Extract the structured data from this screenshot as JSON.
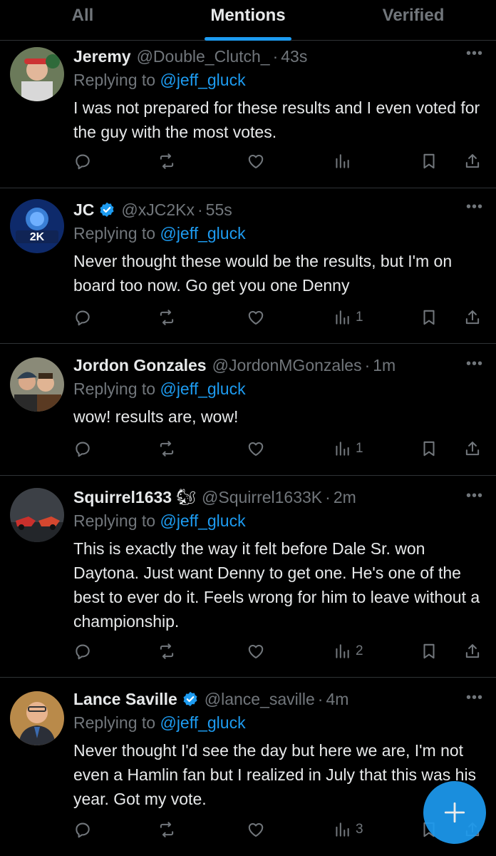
{
  "tabs": [
    {
      "label": "All"
    },
    {
      "label": "Mentions"
    },
    {
      "label": "Verified"
    }
  ],
  "reply_prefix": "Replying to",
  "more_label": "•••",
  "colors": {
    "accent": "#1d9bf0",
    "muted": "#71767b",
    "text": "#e7e9ea",
    "background": "#000000",
    "divider": "#2f3336"
  },
  "tweets": [
    {
      "name": "Jeremy",
      "verified": false,
      "emoji": "",
      "handle": "@Double_Clutch_",
      "time": "43s",
      "reply_to": "@jeff_gluck",
      "text": "I was not prepared for these results and I even voted for the guy with the most votes.",
      "views": ""
    },
    {
      "name": "JC",
      "verified": true,
      "emoji": "",
      "handle": "@xJC2Kx",
      "time": "55s",
      "reply_to": "@jeff_gluck",
      "text": "Never thought these would be the results, but I'm on board too now. Go get you one Denny",
      "views": "1"
    },
    {
      "name": "Jordon Gonzales",
      "verified": false,
      "emoji": "",
      "handle": "@JordonMGonzales",
      "time": "1m",
      "reply_to": "@jeff_gluck",
      "text": "wow! results are, wow!",
      "views": "1"
    },
    {
      "name": "Squirrel1633",
      "verified": false,
      "emoji": "🐿",
      "handle": "@Squirrel1633K",
      "time": "2m",
      "reply_to": "@jeff_gluck",
      "text": "This is exactly the way it felt before Dale Sr. won Daytona.  Just want Denny to get one.   He's one of the best to ever do it.  Feels wrong for him to leave without a championship.",
      "views": "2"
    },
    {
      "name": "Lance Saville",
      "verified": true,
      "emoji": "",
      "handle": "@lance_saville",
      "time": "4m",
      "reply_to": "@jeff_gluck",
      "text": "Never thought I'd see the day but here we are, I'm not even a Hamlin fan but I realized in July that this was his year. Got my vote.",
      "views": "3"
    }
  ],
  "avatar_badges": {
    "jc": "2K"
  }
}
